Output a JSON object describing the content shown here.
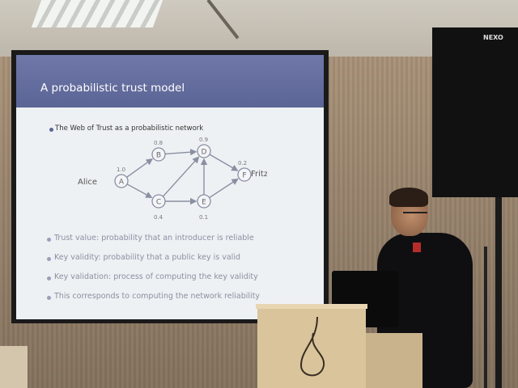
{
  "slide": {
    "title": "A probabilistic trust model",
    "main_bullet": "The Web of Trust as a probabilistic network",
    "nav_text": "",
    "bullets": [
      "Trust value: probability that an introducer is reliable",
      "Key validity: probability that a public key is valid",
      "Key validation: process of computing the key validity",
      "This corresponds to computing the network reliability"
    ]
  },
  "diagram": {
    "start_label": "Alice",
    "end_label": "Fritz",
    "nodes": [
      {
        "id": "A",
        "value": "1.0"
      },
      {
        "id": "B",
        "value": "0.8"
      },
      {
        "id": "C",
        "value": "0.4"
      },
      {
        "id": "D",
        "value": "0.9"
      },
      {
        "id": "E",
        "value": "0.1"
      },
      {
        "id": "F",
        "value": "0.2"
      }
    ],
    "edges": [
      [
        "A",
        "B"
      ],
      [
        "A",
        "C"
      ],
      [
        "B",
        "D"
      ],
      [
        "C",
        "D"
      ],
      [
        "C",
        "E"
      ],
      [
        "E",
        "D"
      ],
      [
        "D",
        "F"
      ],
      [
        "E",
        "F"
      ]
    ]
  },
  "speaker_logo": "NEXO",
  "colors": {
    "slide_header": "#5b6596",
    "slide_bg": "#eef1f3",
    "node_stroke": "#8a8fa2",
    "accent": "#b52d2b"
  }
}
